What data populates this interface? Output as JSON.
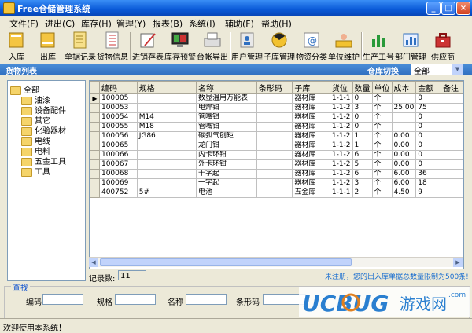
{
  "window": {
    "title": "Free仓储管理系统"
  },
  "menu": [
    {
      "label": "文件(F)"
    },
    {
      "label": "进出(C)"
    },
    {
      "label": "库存(H)"
    },
    {
      "label": "管理(Y)"
    },
    {
      "label": "报表(B)"
    },
    {
      "label": "系统(I)"
    },
    {
      "label": "辅助(F)"
    },
    {
      "label": "帮助(H)"
    }
  ],
  "toolbar": [
    {
      "label": "入库",
      "icon": "book-in-icon"
    },
    {
      "label": "出库",
      "icon": "book-out-icon"
    },
    {
      "label": "单据记录",
      "icon": "doc-record-icon"
    },
    {
      "label": "货物信息",
      "icon": "goods-info-icon"
    },
    {
      "label": "进销存表",
      "icon": "report-pen-icon"
    },
    {
      "label": "库存预警",
      "icon": "monitor-warn-icon"
    },
    {
      "label": "台帐导出",
      "icon": "export-icon"
    },
    {
      "label": "用户管理",
      "icon": "user-manage-icon"
    },
    {
      "label": "子库管理",
      "icon": "sub-store-icon"
    },
    {
      "label": "物资分类",
      "icon": "category-icon"
    },
    {
      "label": "单位维护",
      "icon": "unit-icon"
    },
    {
      "label": "生产工号",
      "icon": "chart-icon"
    },
    {
      "label": "部门管理",
      "icon": "dept-chart-icon"
    },
    {
      "label": "供应商",
      "icon": "supplier-icon"
    }
  ],
  "section": {
    "title": "货物列表",
    "switch_label": "仓库切换",
    "warehouse_selected": "全部"
  },
  "tree": {
    "root": "全部",
    "children": [
      "油漆",
      "设备配件",
      "其它",
      "化验器材",
      "电线",
      "电料",
      "五金工具",
      "工具"
    ]
  },
  "table": {
    "columns": [
      "编码",
      "规格",
      "名称",
      "条形码",
      "子库",
      "货位",
      "数量",
      "单位",
      "成本",
      "金额",
      "备注"
    ],
    "rows": [
      [
        "100005",
        "",
        "数显温用万能表",
        "",
        "器材库",
        "1-1-1",
        "0",
        "个",
        "",
        "0",
        ""
      ],
      [
        "100053",
        "",
        "电焊钳",
        "",
        "器材库",
        "1-1-2",
        "3",
        "个",
        "25.00",
        "75",
        ""
      ],
      [
        "100054",
        "M14",
        "管嘴钳",
        "",
        "器材库",
        "1-1-2",
        "0",
        "个",
        "",
        "0",
        ""
      ],
      [
        "100055",
        "M18",
        "管嘴钳",
        "",
        "器材库",
        "1-1-2",
        "0",
        "个",
        "",
        "0",
        ""
      ],
      [
        "100056",
        "JG86",
        "碳弧气刨矩",
        "",
        "器材库",
        "1-1-2",
        "1",
        "个",
        "0.00",
        "0",
        ""
      ],
      [
        "100065",
        "",
        "龙门钳",
        "",
        "器材库",
        "1-1-2",
        "1",
        "个",
        "0.00",
        "0",
        ""
      ],
      [
        "100066",
        "",
        "内卡环钳",
        "",
        "器材库",
        "1-1-2",
        "6",
        "个",
        "0.00",
        "0",
        ""
      ],
      [
        "100067",
        "",
        "外卡环钳",
        "",
        "器材库",
        "1-1-2",
        "5",
        "个",
        "0.00",
        "0",
        ""
      ],
      [
        "100068",
        "",
        "十字起",
        "",
        "器材库",
        "1-1-2",
        "6",
        "个",
        "6.00",
        "36",
        ""
      ],
      [
        "100069",
        "",
        "一字起",
        "",
        "器材库",
        "1-1-2",
        "3",
        "个",
        "6.00",
        "18",
        ""
      ],
      [
        "400752",
        "5#",
        "电池",
        "",
        "五金库",
        "1-1-1",
        "2",
        "个",
        "4.50",
        "9",
        ""
      ]
    ]
  },
  "footer": {
    "record_label": "记录数:",
    "record_count": "11",
    "notice": "未注册，您的出入库单据总数量限制为500条!"
  },
  "search": {
    "legend": "查找",
    "code_label": "编码",
    "spec_label": "规格",
    "name_label": "名称",
    "barcode_label": "条形码"
  },
  "status": {
    "text": "欢迎使用本系统！"
  },
  "watermark": {
    "brand": "UCBUG",
    "site": "游戏网",
    "url": ".com"
  }
}
